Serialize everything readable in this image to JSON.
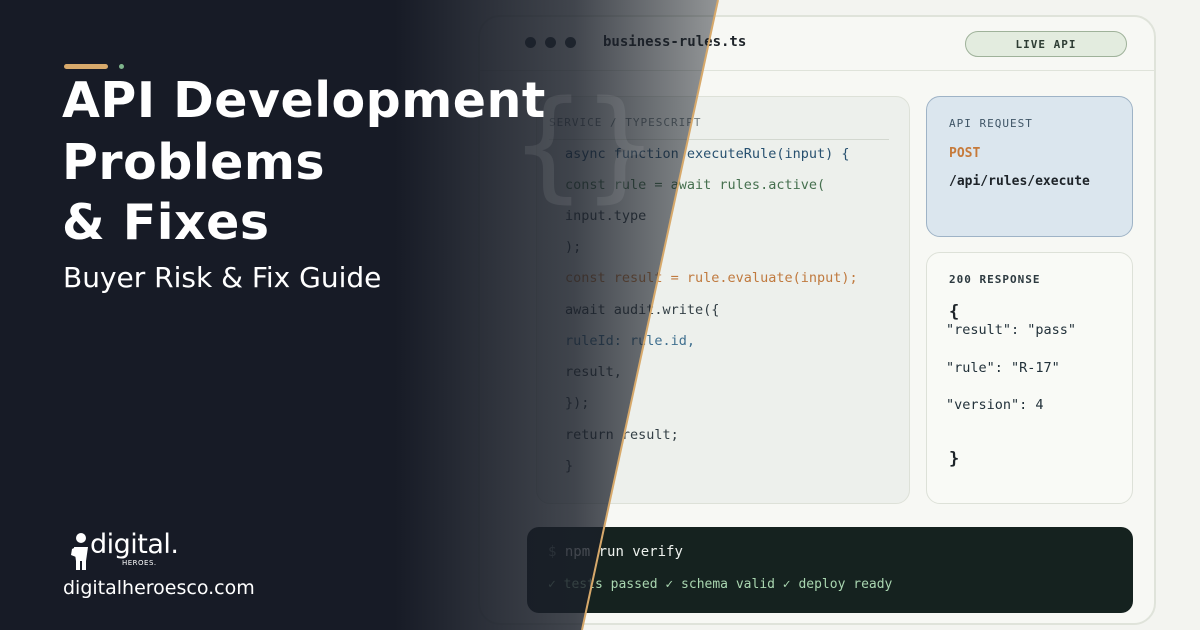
{
  "brand": {
    "headline_lines": [
      "API Development",
      "Problems",
      "& Fixes"
    ],
    "subtitle": "Buyer Risk & Fix Guide",
    "logo_word": "digital.",
    "logo_sub": "HEROES.",
    "website": "digitalheroesco.com",
    "accent_color": "#d7a96b",
    "accent_dot_color": "#7fb58c",
    "panel_color": "#171b26"
  },
  "window": {
    "filename": "business-rules.ts",
    "badge": "LIVE API"
  },
  "code": {
    "header": "SERVICE / TYPESCRIPT",
    "lines": [
      "async function executeRule(input) {",
      "const rule = await rules.active(",
      "input.type",
      ");",
      "const result = rule.evaluate(input);",
      "await audit.write({",
      "ruleId: rule.id,",
      "result,",
      "});",
      "return result;",
      "}"
    ]
  },
  "request": {
    "label": "API REQUEST",
    "method": "POST",
    "path": "/api/rules/execute"
  },
  "response": {
    "label": "200 RESPONSE",
    "open_brace": "{",
    "lines": [
      "\"result\": \"pass\"",
      "\"rule\": \"R-17\"",
      "\"version\": 4"
    ],
    "close_brace": "}"
  },
  "terminal": {
    "prompt": "$",
    "command": "npm run verify",
    "output": "✓ tests passed ✓ schema valid ✓ deploy ready"
  }
}
